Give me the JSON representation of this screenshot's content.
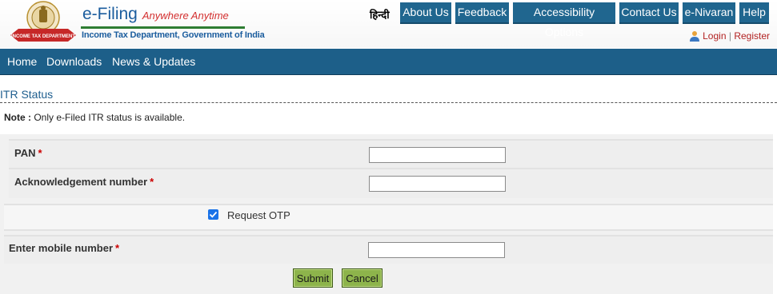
{
  "header": {
    "brand_title": "e-Filing",
    "brand_tagline": "Anywhere Anytime",
    "brand_subtitle": "Income Tax Department, Government of India",
    "emblem_ribbon_text": "INCOME TAX DEPARTMENT",
    "language_link": "हिन्दी",
    "top_links": [
      "About Us",
      "Feedback",
      "Accessibility Options",
      "Contact Us",
      "e-Nivaran",
      "Help"
    ],
    "login_label": "Login",
    "separator": "|",
    "register_label": "Register",
    "icons": {
      "user": "user-icon",
      "emblem": "emblem-logo"
    },
    "colors": {
      "nav_blue": "#1d5f89",
      "brand_blue": "#1b5d9e",
      "tagline_red": "#d32f2f",
      "brand_green": "#2e7d32"
    }
  },
  "main_nav": {
    "items": [
      "Home",
      "Downloads",
      "News & Updates"
    ]
  },
  "page": {
    "title": "ITR Status"
  },
  "note": {
    "label": "Note :",
    "text": " Only e-Filed ITR status is available."
  },
  "form": {
    "pan": {
      "label": "PAN",
      "required": "*",
      "value": ""
    },
    "ack": {
      "label": "Acknowledgement number",
      "required": "*",
      "value": ""
    },
    "otp": {
      "label": "Request OTP",
      "checked": true
    },
    "mobile": {
      "label": "Enter mobile number",
      "required": "*",
      "value": ""
    },
    "submit_label": "Submit",
    "cancel_label": "Cancel",
    "colors": {
      "button_green": "#8db44b",
      "checkbox_blue": "#1a73e8"
    }
  }
}
